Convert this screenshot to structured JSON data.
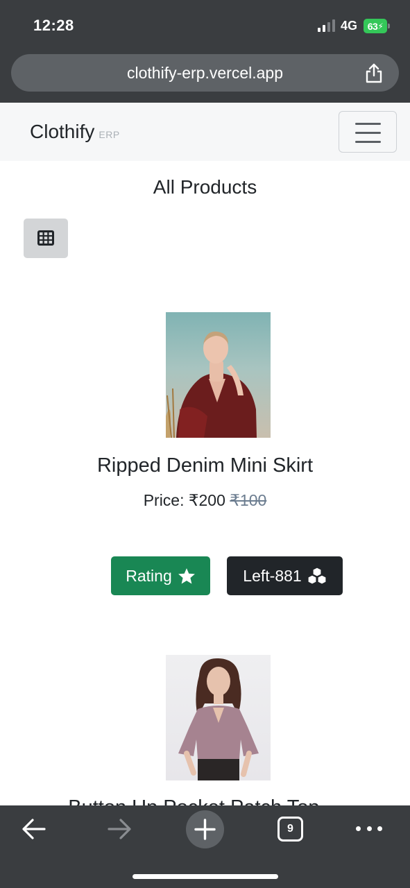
{
  "status_bar": {
    "time": "12:28",
    "network": "4G",
    "battery": "63"
  },
  "browser": {
    "url": "clothify-erp.vercel.app",
    "open_tabs": "9"
  },
  "navbar": {
    "brand": "Clothify",
    "brand_sub": "ERP"
  },
  "page": {
    "title": "All Products"
  },
  "products": [
    {
      "name": "Ripped Denim Mini Skirt",
      "price_label": "Price:",
      "price": "₹200",
      "old_price": "₹100",
      "rating_label": "Rating",
      "stock_label": "Left-881"
    },
    {
      "name": "Button Up Pocket Patch Top ..."
    }
  ],
  "colors": {
    "success": "#198754",
    "dark": "#212529",
    "navbar_bg": "#f6f7f8",
    "browser_chrome": "#3a3d40"
  },
  "icons": {
    "grid_toggle": "table-cells-icon",
    "rating": "star-icon",
    "stock": "cubes-icon"
  }
}
